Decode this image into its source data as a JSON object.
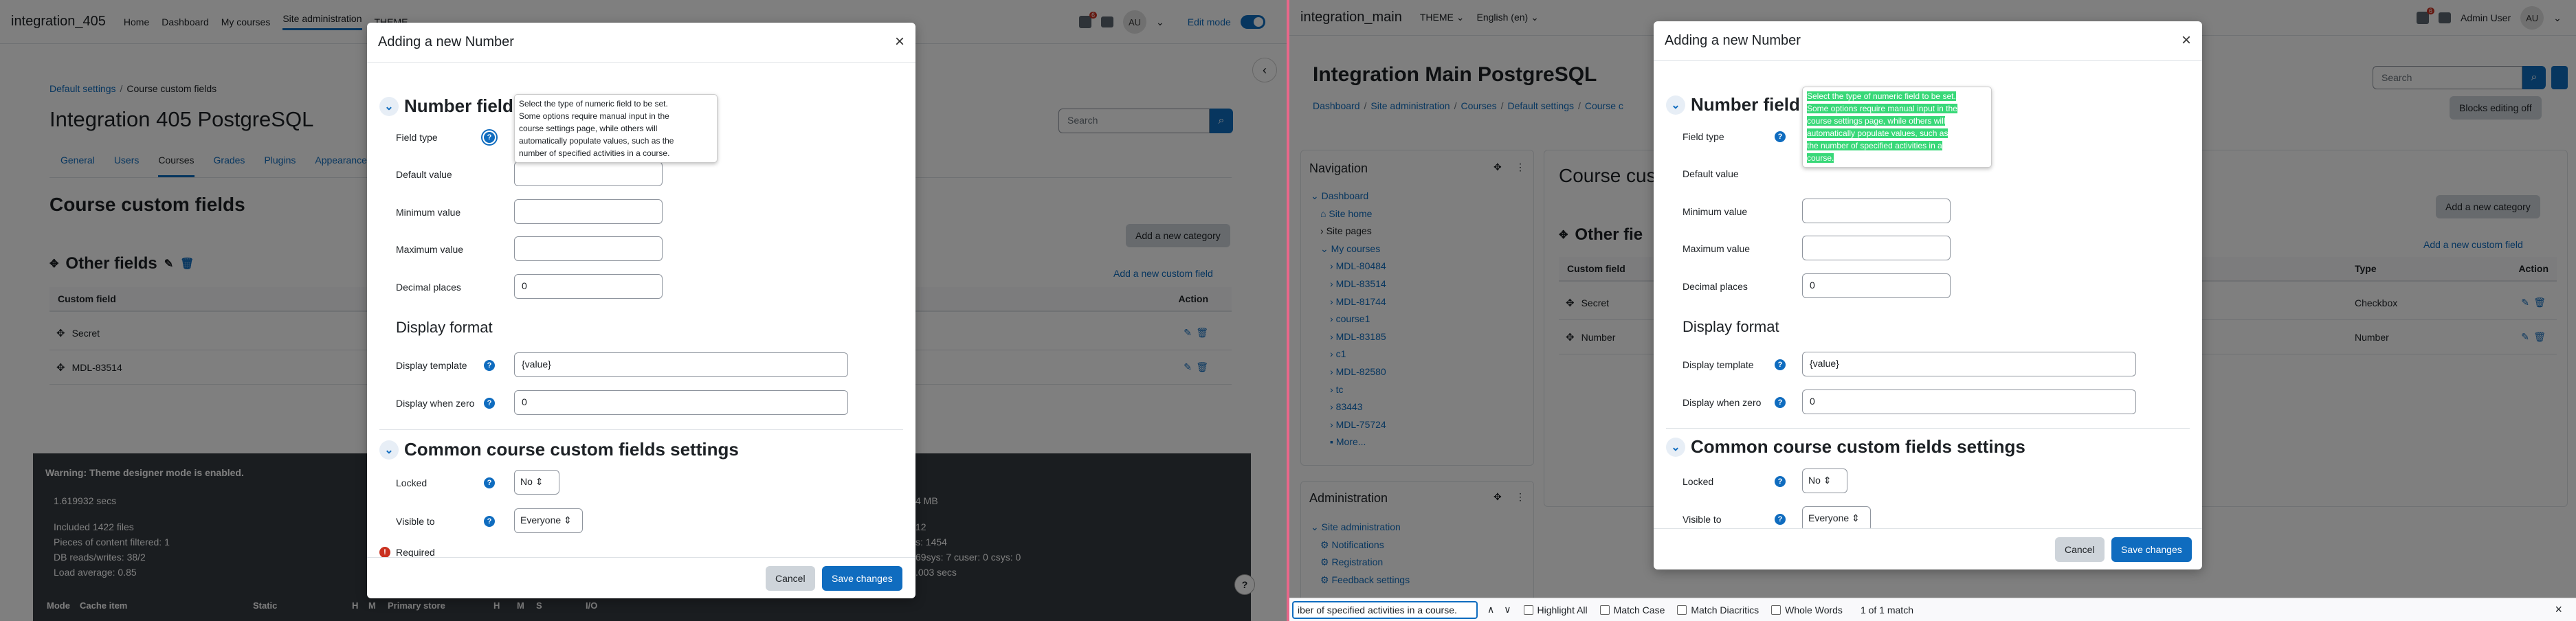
{
  "left": {
    "brand": "integration_405",
    "nav": [
      "Home",
      "Dashboard",
      "My courses",
      "Site administration",
      "THEME"
    ],
    "badge": "6",
    "avatar": "AU",
    "edit_mode": "Edit mode",
    "breadcrumb": [
      "Default settings",
      "Course custom fields"
    ],
    "title": "Integration 405 PostgreSQL",
    "search_placeholder": "Search",
    "tabs": [
      "General",
      "Users",
      "Courses",
      "Grades",
      "Plugins",
      "Appearance"
    ],
    "page_heading": "Course custom fields",
    "add_category": "Add a new category",
    "category": "Other fields",
    "add_field": "Add a new custom field",
    "table": {
      "col_field": "Custom field",
      "col_action": "Action",
      "rows": [
        "Secret",
        "MDL-83514"
      ]
    },
    "footer": {
      "warning": "Warning: Theme designer mode is enabled.",
      "lines": [
        "1.619932 secs",
        "Included 1422 files",
        "Pieces of content filtered: 1",
        "DB reads/writes: 38/2",
        "Load average: 0.85"
      ],
      "right": [
        "4 MB",
        "12",
        "s: 1454",
        "69sys: 7 cuser: 0 csys: 0",
        ".003 secs"
      ],
      "cols": [
        "Mode",
        "Cache item",
        "Static",
        "H",
        "M",
        "Primary store",
        "H",
        "M",
        "S",
        "I/O"
      ]
    },
    "modal": {
      "title": "Adding a new Number",
      "section1": "Number field",
      "labels": [
        "Field type",
        "Default value",
        "Minimum value",
        "Maximum value",
        "Decimal places"
      ],
      "decimal_value": "0",
      "section_display": "Display format",
      "display_template_label": "Display template",
      "display_template_value": "{value}",
      "display_zero_label": "Display when zero",
      "display_zero_value": "0",
      "section2": "Common course custom fields settings",
      "locked_label": "Locked",
      "locked_value": "No",
      "visible_label": "Visible to",
      "visible_value": "Everyone",
      "required": "Required",
      "cancel": "Cancel",
      "save": "Save changes",
      "tooltip_lines": [
        "Select the type of numeric field to be set.",
        "Some options require manual input in the",
        "course settings page, while others will",
        "automatically populate values, such as the",
        "number of specified activities in a course."
      ]
    }
  },
  "right": {
    "brand": "integration_main",
    "theme": "THEME",
    "lang": "English (en)",
    "badge": "6",
    "user": "Admin User",
    "avatar": "AU",
    "title": "Integration Main PostgreSQL",
    "breadcrumb": [
      "Dashboard",
      "Site administration",
      "Courses",
      "Default settings",
      "Course c"
    ],
    "search_placeholder": "Search",
    "blocks_btn": "Blocks editing off",
    "nav_block": "Navigation",
    "nav_items": [
      "Dashboard",
      "Site home",
      "Site pages",
      "My courses",
      "MDL-80484",
      "MDL-83514",
      "MDL-81744",
      "course1",
      "MDL-83185",
      "c1",
      "MDL-82580",
      "tc",
      "83443",
      "MDL-75724",
      "More..."
    ],
    "admin_block": "Administration",
    "admin_items": [
      "Site administration",
      "Notifications",
      "Registration",
      "Feedback settings"
    ],
    "page_heading": "Course cus",
    "add_category": "Add a new category",
    "category": "Other fie",
    "add_field": "Add a new custom field",
    "table": {
      "col_field": "Custom field",
      "col_type": "Type",
      "col_action": "Action",
      "rows": [
        {
          "name": "Secret",
          "type": "Checkbox"
        },
        {
          "name": "Number",
          "type": "Number"
        }
      ]
    },
    "modal": {
      "title": "Adding a new Number",
      "section1": "Number field",
      "labels": [
        "Field type",
        "Default value",
        "Minimum value",
        "Maximum value",
        "Decimal places"
      ],
      "decimal_value": "0",
      "section_display": "Display format",
      "display_template_label": "Display template",
      "display_template_value": "{value}",
      "display_zero_label": "Display when zero",
      "display_zero_value": "0",
      "section2": "Common course custom fields settings",
      "locked_label": "Locked",
      "locked_value": "No",
      "visible_label": "Visible to",
      "visible_value": "Everyone",
      "cancel": "Cancel",
      "save": "Save changes",
      "tooltip_lines": [
        "Select the type of numeric field to be set.",
        "Some options require manual input in the",
        "course settings page, while others will",
        "automatically populate values, such as",
        "the number of specified activities in a",
        "course."
      ]
    },
    "find": {
      "query": "iber of specified activities in a course.",
      "highlight_all": "Highlight All",
      "match_case": "Match Case",
      "match_diacritics": "Match Diacritics",
      "whole_words": "Whole Words",
      "result": "1 of 1 match"
    }
  }
}
